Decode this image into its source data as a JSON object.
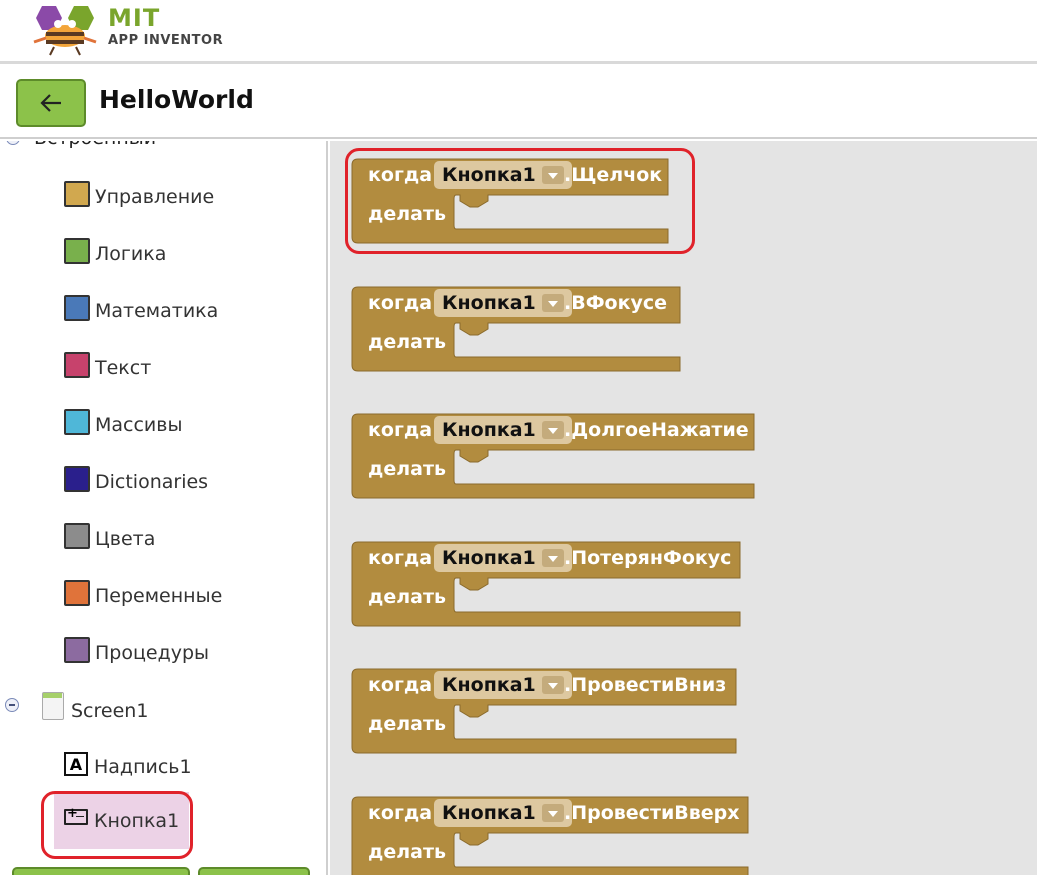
{
  "header": {
    "brand": "MIT",
    "brand_sub": "APP INVENTOR"
  },
  "project": {
    "title": "HelloWorld",
    "back_icon": "arrow-left-icon"
  },
  "sidebar": {
    "group_label": "Встроенный",
    "categories": [
      {
        "label": "Управление",
        "color": "#d1a84f"
      },
      {
        "label": "Логика",
        "color": "#79b04c"
      },
      {
        "label": "Математика",
        "color": "#4a79b8"
      },
      {
        "label": "Текст",
        "color": "#c7426c"
      },
      {
        "label": "Массивы",
        "color": "#4fb7d8"
      },
      {
        "label": "Dictionaries",
        "color": "#2a1f8c"
      },
      {
        "label": "Цвета",
        "color": "#8c8c8c"
      },
      {
        "label": "Переменные",
        "color": "#e0733a"
      },
      {
        "label": "Процедуры",
        "color": "#8c6ba0"
      }
    ],
    "screen": {
      "label": "Screen1"
    },
    "components": [
      {
        "label": "Надпись1",
        "icon": "label-icon"
      },
      {
        "label": "Кнопка1",
        "icon": "button-icon",
        "selected": true
      }
    ]
  },
  "workspace": {
    "block_color": "#b28c3f",
    "keyword_when": "когда",
    "keyword_do": "делать",
    "blocks": [
      {
        "component": "Кнопка1",
        "event": ".Щелчок",
        "highlighted": true
      },
      {
        "component": "Кнопка1",
        "event": ".ВФокусе"
      },
      {
        "component": "Кнопка1",
        "event": ".ДолгоеНажатие"
      },
      {
        "component": "Кнопка1",
        "event": ".ПотерянФокус"
      },
      {
        "component": "Кнопка1",
        "event": ".ПровестиВниз"
      },
      {
        "component": "Кнопка1",
        "event": ".ПровестиВверх"
      }
    ]
  }
}
